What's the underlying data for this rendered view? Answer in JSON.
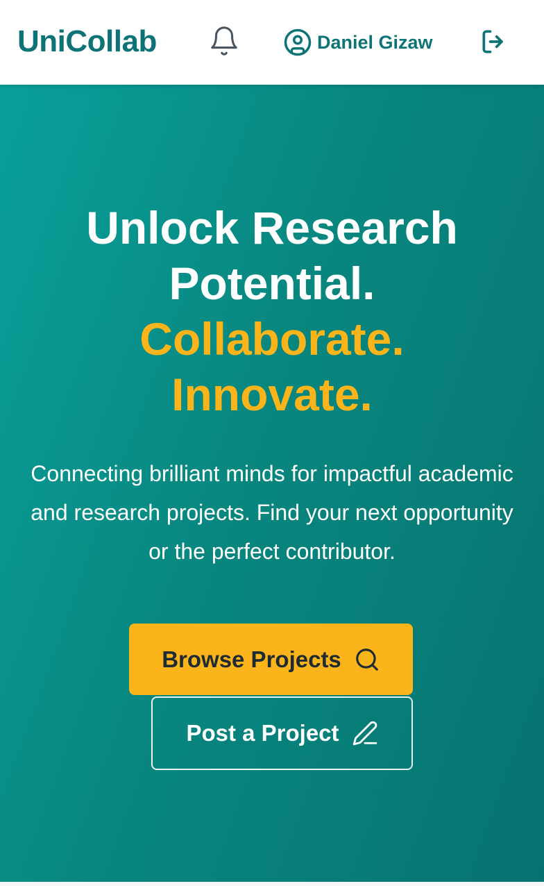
{
  "header": {
    "brand": "UniCollab",
    "user_name": "Daniel Gizaw",
    "icons": {
      "notifications": "bell-icon",
      "user": "user-circle-icon",
      "logout": "logout-icon"
    }
  },
  "hero": {
    "headline_line1": "Unlock Research",
    "headline_line2": "Potential.",
    "headline_line3": "Collaborate.",
    "headline_line4": "Innovate.",
    "subtitle": "Connecting brilliant minds for impactful academic and research projects. Find your next opportunity or the perfect contributor.",
    "primary_button": {
      "label": "Browse Projects",
      "icon": "search-icon"
    },
    "secondary_button": {
      "label": "Post a Project",
      "icon": "pencil-icon"
    }
  },
  "colors": {
    "brand": "#0d7377",
    "hero_gradient_start": "#0a9f9b",
    "hero_gradient_end": "#077371",
    "accent": "#fbb41a",
    "white": "#ffffff"
  }
}
